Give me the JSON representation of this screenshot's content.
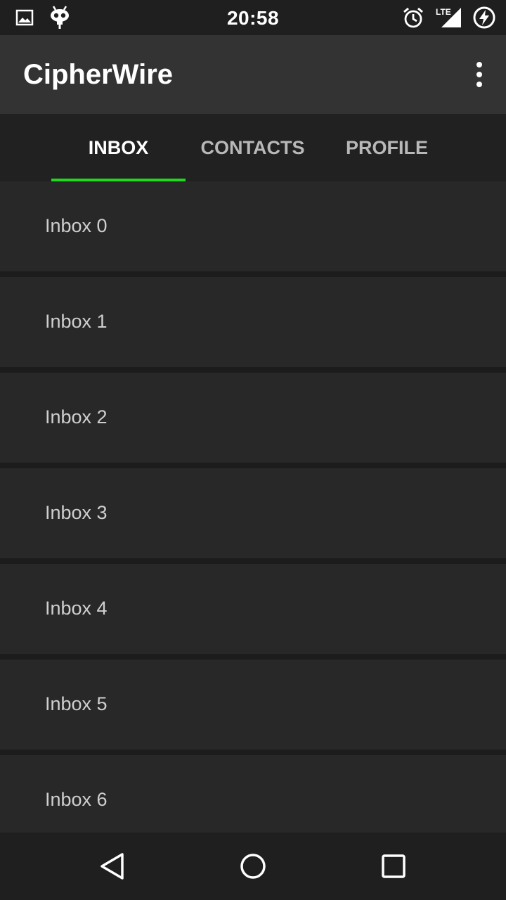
{
  "status_bar": {
    "time": "20:58",
    "left_icons": [
      "image-icon",
      "android-debug-icon"
    ],
    "right_icons": [
      "alarm-icon",
      "lte-signal-icon",
      "battery-charging-icon"
    ],
    "network_label": "LTE"
  },
  "app_bar": {
    "title": "CipherWire",
    "overflow_icon": "more-vert-icon"
  },
  "tabs": [
    {
      "label": "INBOX",
      "active": true
    },
    {
      "label": "CONTACTS",
      "active": false
    },
    {
      "label": "PROFILE",
      "active": false
    }
  ],
  "colors": {
    "accent": "#1fd91f",
    "app_bar": "#333333",
    "tab_bar": "#212121",
    "list_item": "#282828",
    "background": "#1c1c1c"
  },
  "inbox_items": [
    {
      "label": "Inbox 0"
    },
    {
      "label": "Inbox 1"
    },
    {
      "label": "Inbox 2"
    },
    {
      "label": "Inbox 3"
    },
    {
      "label": "Inbox 4"
    },
    {
      "label": "Inbox 5"
    },
    {
      "label": "Inbox 6"
    }
  ],
  "nav_bar": {
    "buttons": [
      "back-icon",
      "home-icon",
      "recents-icon"
    ]
  }
}
